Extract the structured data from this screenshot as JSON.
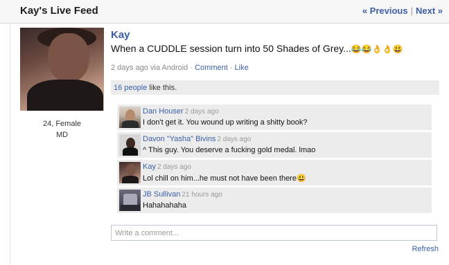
{
  "header": {
    "title": "Kay's Live Feed",
    "previous_label": "« Previous",
    "separator": "|",
    "next_label": "Next »"
  },
  "profile": {
    "age_gender": "24, Female",
    "location": "MD"
  },
  "post": {
    "author": "Kay",
    "text": "When a CUDDLE session turn into 50 Shades of Grey...",
    "emoji": "😂😂👌👌😃",
    "time": "2 days ago via Android",
    "dot1": " · ",
    "comment_label": "Comment",
    "dot2": " · ",
    "like_label": "Like"
  },
  "likes": {
    "count_label": "16 people",
    "suffix": " like this."
  },
  "comments": [
    {
      "name": "Dan Houser",
      "time": "2 days ago",
      "text": "I don't get it. You wound up writing a shitty book?",
      "avatar_icon": "person-avatar-icon"
    },
    {
      "name": "Davon \"Yasha\" Bivins",
      "time": "2 days ago",
      "text": "^ This guy. You deserve a fucking gold medal. lmao",
      "avatar_icon": "person-avatar-icon"
    },
    {
      "name": "Kay",
      "time": "2 days ago",
      "text": "Lol chill on him...he must not have been there😃",
      "avatar_icon": "person-avatar-icon"
    },
    {
      "name": "JB Sullivan",
      "time": "21 hours ago",
      "text": "Hahahahaha",
      "avatar_icon": "person-avatar-icon"
    }
  ],
  "comment_box": {
    "placeholder": "Write a comment..."
  },
  "footer": {
    "refresh_label": "Refresh"
  },
  "colors": {
    "link": "#3b5ea7",
    "panel": "#ececec"
  }
}
